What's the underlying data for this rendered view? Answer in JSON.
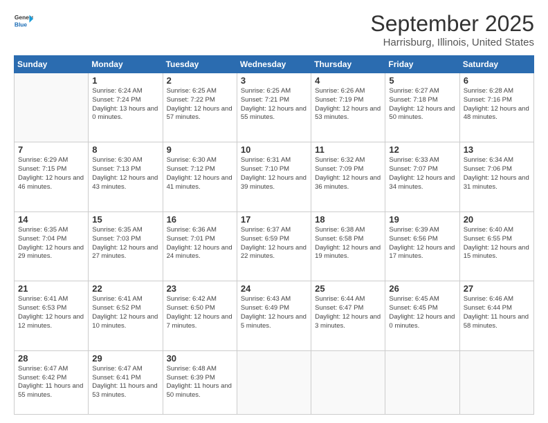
{
  "logo": {
    "line1": "General",
    "line2": "Blue"
  },
  "title": "September 2025",
  "subtitle": "Harrisburg, Illinois, United States",
  "weekdays": [
    "Sunday",
    "Monday",
    "Tuesday",
    "Wednesday",
    "Thursday",
    "Friday",
    "Saturday"
  ],
  "weeks": [
    [
      {
        "day": "",
        "sunrise": "",
        "sunset": "",
        "daylight": ""
      },
      {
        "day": "1",
        "sunrise": "Sunrise: 6:24 AM",
        "sunset": "Sunset: 7:24 PM",
        "daylight": "Daylight: 13 hours and 0 minutes."
      },
      {
        "day": "2",
        "sunrise": "Sunrise: 6:25 AM",
        "sunset": "Sunset: 7:22 PM",
        "daylight": "Daylight: 12 hours and 57 minutes."
      },
      {
        "day": "3",
        "sunrise": "Sunrise: 6:25 AM",
        "sunset": "Sunset: 7:21 PM",
        "daylight": "Daylight: 12 hours and 55 minutes."
      },
      {
        "day": "4",
        "sunrise": "Sunrise: 6:26 AM",
        "sunset": "Sunset: 7:19 PM",
        "daylight": "Daylight: 12 hours and 53 minutes."
      },
      {
        "day": "5",
        "sunrise": "Sunrise: 6:27 AM",
        "sunset": "Sunset: 7:18 PM",
        "daylight": "Daylight: 12 hours and 50 minutes."
      },
      {
        "day": "6",
        "sunrise": "Sunrise: 6:28 AM",
        "sunset": "Sunset: 7:16 PM",
        "daylight": "Daylight: 12 hours and 48 minutes."
      }
    ],
    [
      {
        "day": "7",
        "sunrise": "Sunrise: 6:29 AM",
        "sunset": "Sunset: 7:15 PM",
        "daylight": "Daylight: 12 hours and 46 minutes."
      },
      {
        "day": "8",
        "sunrise": "Sunrise: 6:30 AM",
        "sunset": "Sunset: 7:13 PM",
        "daylight": "Daylight: 12 hours and 43 minutes."
      },
      {
        "day": "9",
        "sunrise": "Sunrise: 6:30 AM",
        "sunset": "Sunset: 7:12 PM",
        "daylight": "Daylight: 12 hours and 41 minutes."
      },
      {
        "day": "10",
        "sunrise": "Sunrise: 6:31 AM",
        "sunset": "Sunset: 7:10 PM",
        "daylight": "Daylight: 12 hours and 39 minutes."
      },
      {
        "day": "11",
        "sunrise": "Sunrise: 6:32 AM",
        "sunset": "Sunset: 7:09 PM",
        "daylight": "Daylight: 12 hours and 36 minutes."
      },
      {
        "day": "12",
        "sunrise": "Sunrise: 6:33 AM",
        "sunset": "Sunset: 7:07 PM",
        "daylight": "Daylight: 12 hours and 34 minutes."
      },
      {
        "day": "13",
        "sunrise": "Sunrise: 6:34 AM",
        "sunset": "Sunset: 7:06 PM",
        "daylight": "Daylight: 12 hours and 31 minutes."
      }
    ],
    [
      {
        "day": "14",
        "sunrise": "Sunrise: 6:35 AM",
        "sunset": "Sunset: 7:04 PM",
        "daylight": "Daylight: 12 hours and 29 minutes."
      },
      {
        "day": "15",
        "sunrise": "Sunrise: 6:35 AM",
        "sunset": "Sunset: 7:03 PM",
        "daylight": "Daylight: 12 hours and 27 minutes."
      },
      {
        "day": "16",
        "sunrise": "Sunrise: 6:36 AM",
        "sunset": "Sunset: 7:01 PM",
        "daylight": "Daylight: 12 hours and 24 minutes."
      },
      {
        "day": "17",
        "sunrise": "Sunrise: 6:37 AM",
        "sunset": "Sunset: 6:59 PM",
        "daylight": "Daylight: 12 hours and 22 minutes."
      },
      {
        "day": "18",
        "sunrise": "Sunrise: 6:38 AM",
        "sunset": "Sunset: 6:58 PM",
        "daylight": "Daylight: 12 hours and 19 minutes."
      },
      {
        "day": "19",
        "sunrise": "Sunrise: 6:39 AM",
        "sunset": "Sunset: 6:56 PM",
        "daylight": "Daylight: 12 hours and 17 minutes."
      },
      {
        "day": "20",
        "sunrise": "Sunrise: 6:40 AM",
        "sunset": "Sunset: 6:55 PM",
        "daylight": "Daylight: 12 hours and 15 minutes."
      }
    ],
    [
      {
        "day": "21",
        "sunrise": "Sunrise: 6:41 AM",
        "sunset": "Sunset: 6:53 PM",
        "daylight": "Daylight: 12 hours and 12 minutes."
      },
      {
        "day": "22",
        "sunrise": "Sunrise: 6:41 AM",
        "sunset": "Sunset: 6:52 PM",
        "daylight": "Daylight: 12 hours and 10 minutes."
      },
      {
        "day": "23",
        "sunrise": "Sunrise: 6:42 AM",
        "sunset": "Sunset: 6:50 PM",
        "daylight": "Daylight: 12 hours and 7 minutes."
      },
      {
        "day": "24",
        "sunrise": "Sunrise: 6:43 AM",
        "sunset": "Sunset: 6:49 PM",
        "daylight": "Daylight: 12 hours and 5 minutes."
      },
      {
        "day": "25",
        "sunrise": "Sunrise: 6:44 AM",
        "sunset": "Sunset: 6:47 PM",
        "daylight": "Daylight: 12 hours and 3 minutes."
      },
      {
        "day": "26",
        "sunrise": "Sunrise: 6:45 AM",
        "sunset": "Sunset: 6:45 PM",
        "daylight": "Daylight: 12 hours and 0 minutes."
      },
      {
        "day": "27",
        "sunrise": "Sunrise: 6:46 AM",
        "sunset": "Sunset: 6:44 PM",
        "daylight": "Daylight: 11 hours and 58 minutes."
      }
    ],
    [
      {
        "day": "28",
        "sunrise": "Sunrise: 6:47 AM",
        "sunset": "Sunset: 6:42 PM",
        "daylight": "Daylight: 11 hours and 55 minutes."
      },
      {
        "day": "29",
        "sunrise": "Sunrise: 6:47 AM",
        "sunset": "Sunset: 6:41 PM",
        "daylight": "Daylight: 11 hours and 53 minutes."
      },
      {
        "day": "30",
        "sunrise": "Sunrise: 6:48 AM",
        "sunset": "Sunset: 6:39 PM",
        "daylight": "Daylight: 11 hours and 50 minutes."
      },
      {
        "day": "",
        "sunrise": "",
        "sunset": "",
        "daylight": ""
      },
      {
        "day": "",
        "sunrise": "",
        "sunset": "",
        "daylight": ""
      },
      {
        "day": "",
        "sunrise": "",
        "sunset": "",
        "daylight": ""
      },
      {
        "day": "",
        "sunrise": "",
        "sunset": "",
        "daylight": ""
      }
    ]
  ]
}
